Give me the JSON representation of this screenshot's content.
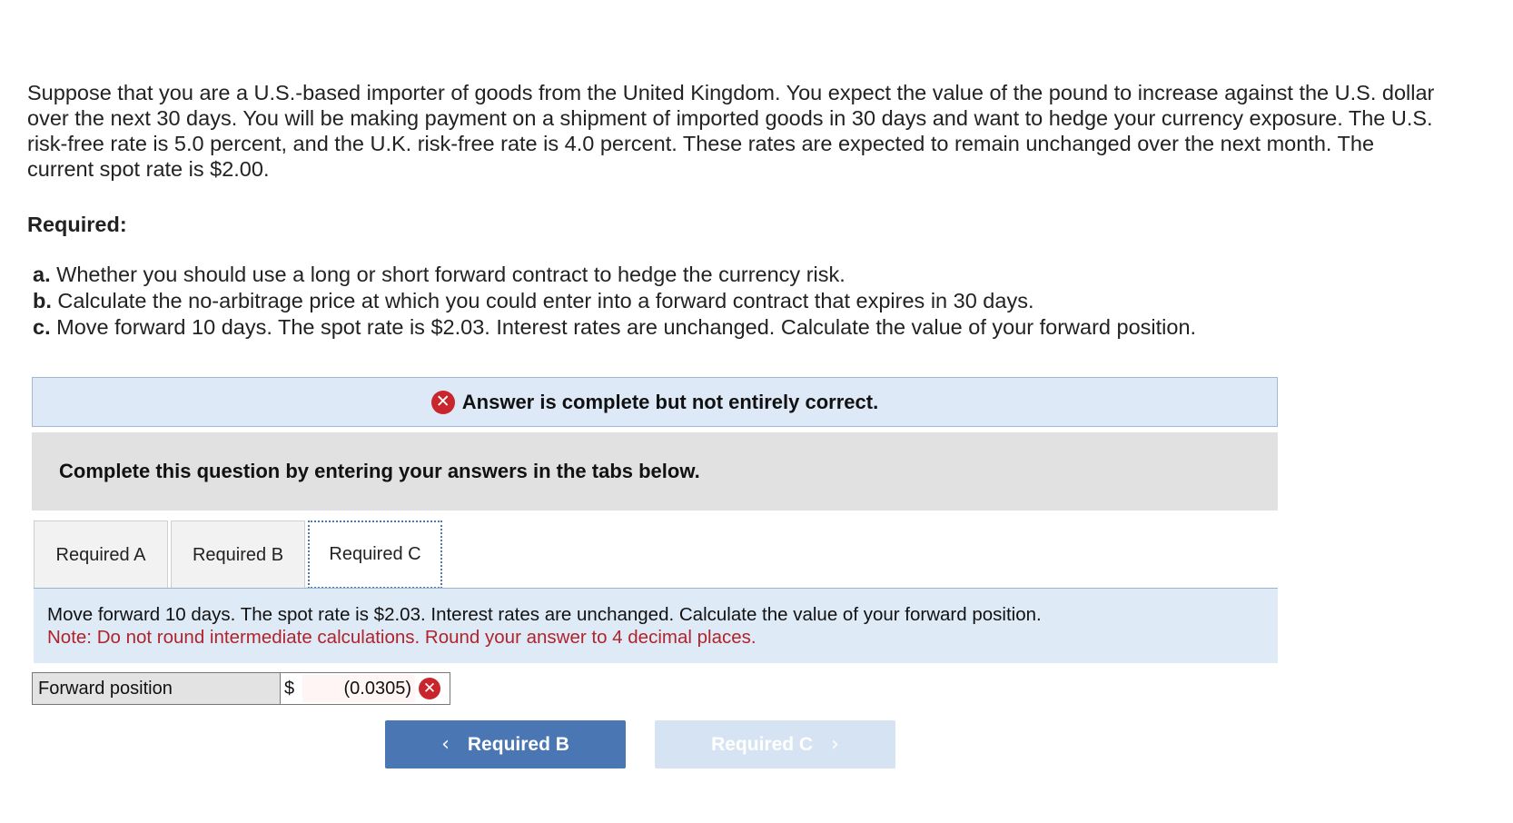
{
  "problem": {
    "text": "Suppose that you are a U.S.-based importer of goods from the United Kingdom. You expect the value of the pound to increase against the U.S. dollar over the next 30 days. You will be making payment on a shipment of imported goods in 30 days and want to hedge your currency exposure. The U.S. risk-free rate is 5.0 percent, and the U.K. risk-free rate is 4.0 percent. These rates are expected to remain unchanged over the next month. The current spot rate is $2.00."
  },
  "required": {
    "heading": "Required:",
    "items": [
      {
        "letter": "a.",
        "text": "Whether you should use a long or short forward contract to hedge the currency risk."
      },
      {
        "letter": "b.",
        "text": "Calculate the no-arbitrage price at which you could enter into a forward contract that expires in 30 days."
      },
      {
        "letter": "c.",
        "text": "Move forward 10 days. The spot rate is $2.03. Interest rates are unchanged. Calculate the value of your forward position."
      }
    ]
  },
  "feedback": {
    "icon": "x-circle-icon",
    "text": "Answer is complete but not entirely correct.",
    "icon_color": "#c8262c"
  },
  "instructions": "Complete this question by entering your answers in the tabs below.",
  "tabs": [
    {
      "label": "Required A",
      "active": false
    },
    {
      "label": "Required B",
      "active": false
    },
    {
      "label": "Required C",
      "active": true
    }
  ],
  "panel": {
    "question": "Move forward 10 days. The spot rate is $2.03. Interest rates are unchanged. Calculate the value of your forward position.",
    "note": "Note: Do not round intermediate calculations. Round your answer to 4 decimal places."
  },
  "answer": {
    "label": "Forward position",
    "currency": "$",
    "value": "(0.0305)",
    "status": "incorrect"
  },
  "nav": {
    "prev_label": "Required B",
    "next_label": "Required C",
    "prev_color": "#4a76b4",
    "next_color": "#d6e3f2"
  }
}
